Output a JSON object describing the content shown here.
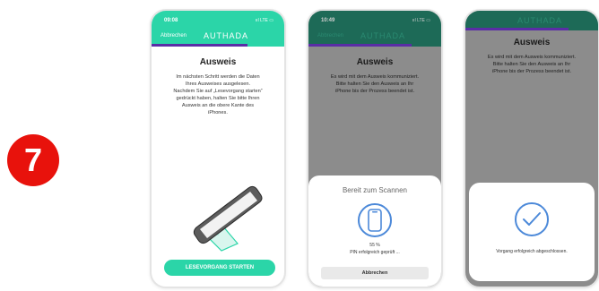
{
  "step_number": "7",
  "colors": {
    "accent": "#2bd5a8",
    "progress": "#5a2da6",
    "badge": "#e8120c",
    "icon_blue": "#4c89d9"
  },
  "screen1": {
    "time": "09:08",
    "status": "ııl LTE ▭",
    "back": "Abbrechen",
    "brand": "AUTHADA",
    "progress": 0.72,
    "title": "Ausweis",
    "description": [
      "Im nächsten Schritt werden die Daten",
      "Ihres Ausweises ausgelesen.",
      "Nachdem Sie auf „Lesevorgang starten“",
      "gedrückt haben, halten Sie bitte Ihren",
      "Ausweis an die obere Kante des",
      "iPhones."
    ],
    "illustration_icon": "phone-on-id-card-icon",
    "button": "LESEVORGANG STARTEN"
  },
  "screen2": {
    "time": "10:49",
    "status": "ııl LTE ▭",
    "back": "Abbrechen",
    "brand": "AUTHADA",
    "progress": 0.78,
    "title": "Ausweis",
    "description": [
      "Es wird mit dem Ausweis kommuniziert.",
      "Bitte halten Sie den Ausweis an Ihr",
      "iPhone bis der Prozess beendet ist."
    ],
    "sheet_title": "Bereit zum Scannen",
    "scan_icon": "iphone-scan-icon",
    "percent": "55 %",
    "pin_message": "PIN erfolgreich geprüft ...",
    "cancel": "Abbrechen"
  },
  "screen3": {
    "brand": "AUTHADA",
    "progress": 0.78,
    "title": "Ausweis",
    "description": [
      "Es wird mit dem Ausweis kommuniziert.",
      "Bitte halten Sie den Ausweis an Ihr",
      "iPhone bis der Prozess beendet ist."
    ],
    "check_icon": "checkmark-icon",
    "done_message": "Vorgang erfolgreich abgeschlossen."
  }
}
